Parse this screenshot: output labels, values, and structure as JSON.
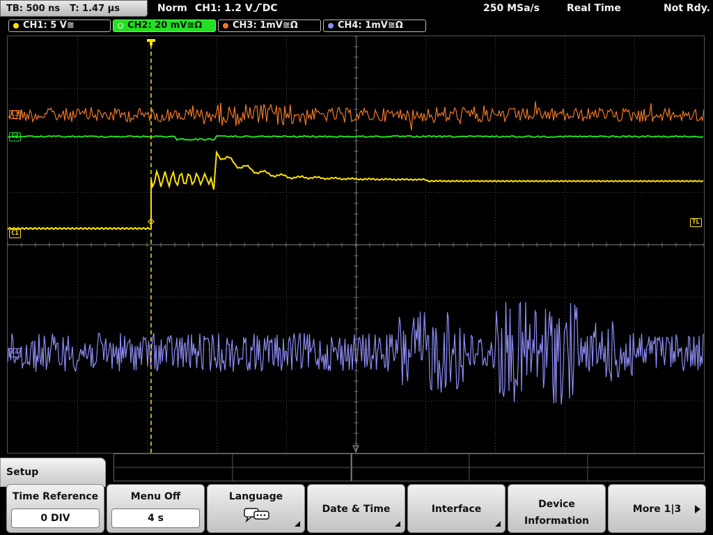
{
  "status": {
    "timebase": "TB: 500 ns",
    "trigger_time": "T: 1.47 µs",
    "trigger_mode": "Norm",
    "trigger_source": "CH1: 1.2 V",
    "trigger_coupling": "DC",
    "sample_rate": "250 MSa/s",
    "acq_mode": "Real Time",
    "acq_status": "Not Rdy."
  },
  "channels": [
    {
      "label": "CH1: 5 V≅",
      "color": "#ffe400"
    },
    {
      "label": "CH2: 20 mV≅Ω",
      "color": "#22e022"
    },
    {
      "label": "CH3: 1mV≅Ω",
      "color": "#f07a28"
    },
    {
      "label": "CH4: 1mV≅Ω",
      "color": "#8e8ef5"
    }
  ],
  "markers": {
    "ch1": "C1",
    "ch2": "C2",
    "ch3": "C3",
    "ch4": "C4",
    "trigger_level": "TL"
  },
  "menu": {
    "title": "Setup",
    "time_reference": {
      "label": "Time Reference",
      "value": "0 DIV"
    },
    "menu_off": {
      "label": "Menu Off",
      "value": "4 s"
    },
    "language": {
      "label": "Language"
    },
    "date_time": {
      "label": "Date & Time"
    },
    "interface": {
      "label": "Interface"
    },
    "device_info": {
      "label_line1": "Device",
      "label_line2": "Information"
    },
    "more": {
      "label": "More 1|3"
    }
  }
}
